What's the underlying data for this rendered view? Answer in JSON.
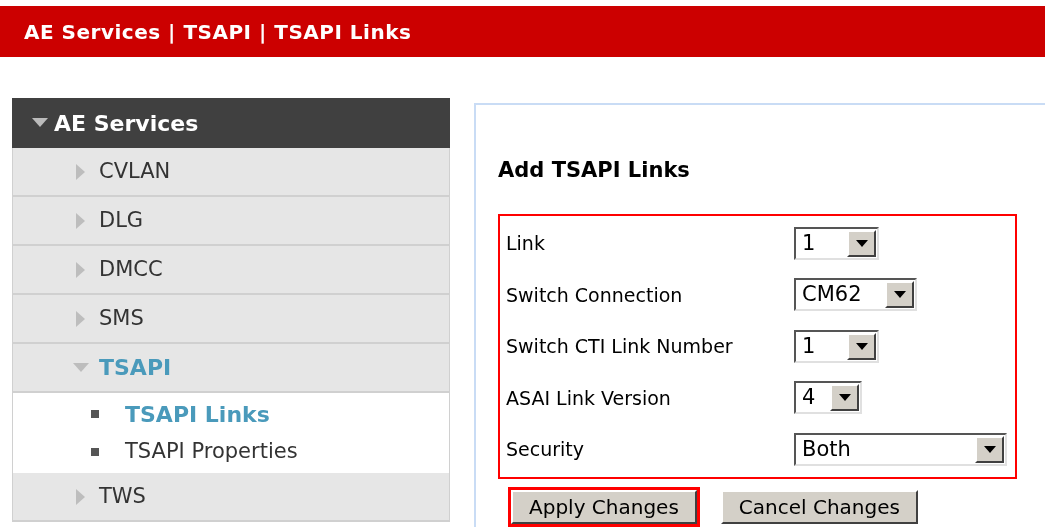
{
  "header": {
    "breadcrumb": "AE Services | TSAPI | TSAPI Links"
  },
  "sidebar": {
    "title": "AE Services",
    "expanded": true,
    "items": [
      {
        "label": "CVLAN",
        "expanded": false,
        "selected": false
      },
      {
        "label": "DLG",
        "expanded": false,
        "selected": false
      },
      {
        "label": "DMCC",
        "expanded": false,
        "selected": false
      },
      {
        "label": "SMS",
        "expanded": false,
        "selected": false
      },
      {
        "label": "TSAPI",
        "expanded": true,
        "selected": true,
        "children": [
          {
            "label": "TSAPI Links",
            "selected": true
          },
          {
            "label": "TSAPI Properties",
            "selected": false
          }
        ]
      },
      {
        "label": "TWS",
        "expanded": false,
        "selected": false
      }
    ]
  },
  "form": {
    "title": "Add TSAPI Links",
    "highlighted": true,
    "fields": [
      {
        "label": "Link",
        "value": "1"
      },
      {
        "label": "Switch Connection",
        "value": "CM62"
      },
      {
        "label": "Switch CTI Link Number",
        "value": "1"
      },
      {
        "label": "ASAI Link Version",
        "value": "4"
      },
      {
        "label": "Security",
        "value": "Both"
      }
    ],
    "buttons": [
      {
        "label": "Apply Changes",
        "highlighted": true
      },
      {
        "label": "Cancel Changes",
        "highlighted": false
      }
    ]
  }
}
